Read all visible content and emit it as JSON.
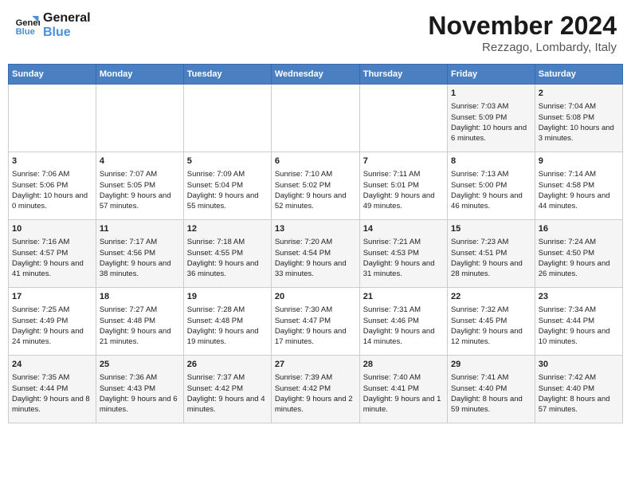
{
  "header": {
    "logo_line1": "General",
    "logo_line2": "Blue",
    "month_title": "November 2024",
    "location": "Rezzago, Lombardy, Italy"
  },
  "days_of_week": [
    "Sunday",
    "Monday",
    "Tuesday",
    "Wednesday",
    "Thursday",
    "Friday",
    "Saturday"
  ],
  "weeks": [
    [
      {
        "day": "",
        "info": ""
      },
      {
        "day": "",
        "info": ""
      },
      {
        "day": "",
        "info": ""
      },
      {
        "day": "",
        "info": ""
      },
      {
        "day": "",
        "info": ""
      },
      {
        "day": "1",
        "info": "Sunrise: 7:03 AM\nSunset: 5:09 PM\nDaylight: 10 hours and 6 minutes."
      },
      {
        "day": "2",
        "info": "Sunrise: 7:04 AM\nSunset: 5:08 PM\nDaylight: 10 hours and 3 minutes."
      }
    ],
    [
      {
        "day": "3",
        "info": "Sunrise: 7:06 AM\nSunset: 5:06 PM\nDaylight: 10 hours and 0 minutes."
      },
      {
        "day": "4",
        "info": "Sunrise: 7:07 AM\nSunset: 5:05 PM\nDaylight: 9 hours and 57 minutes."
      },
      {
        "day": "5",
        "info": "Sunrise: 7:09 AM\nSunset: 5:04 PM\nDaylight: 9 hours and 55 minutes."
      },
      {
        "day": "6",
        "info": "Sunrise: 7:10 AM\nSunset: 5:02 PM\nDaylight: 9 hours and 52 minutes."
      },
      {
        "day": "7",
        "info": "Sunrise: 7:11 AM\nSunset: 5:01 PM\nDaylight: 9 hours and 49 minutes."
      },
      {
        "day": "8",
        "info": "Sunrise: 7:13 AM\nSunset: 5:00 PM\nDaylight: 9 hours and 46 minutes."
      },
      {
        "day": "9",
        "info": "Sunrise: 7:14 AM\nSunset: 4:58 PM\nDaylight: 9 hours and 44 minutes."
      }
    ],
    [
      {
        "day": "10",
        "info": "Sunrise: 7:16 AM\nSunset: 4:57 PM\nDaylight: 9 hours and 41 minutes."
      },
      {
        "day": "11",
        "info": "Sunrise: 7:17 AM\nSunset: 4:56 PM\nDaylight: 9 hours and 38 minutes."
      },
      {
        "day": "12",
        "info": "Sunrise: 7:18 AM\nSunset: 4:55 PM\nDaylight: 9 hours and 36 minutes."
      },
      {
        "day": "13",
        "info": "Sunrise: 7:20 AM\nSunset: 4:54 PM\nDaylight: 9 hours and 33 minutes."
      },
      {
        "day": "14",
        "info": "Sunrise: 7:21 AM\nSunset: 4:53 PM\nDaylight: 9 hours and 31 minutes."
      },
      {
        "day": "15",
        "info": "Sunrise: 7:23 AM\nSunset: 4:51 PM\nDaylight: 9 hours and 28 minutes."
      },
      {
        "day": "16",
        "info": "Sunrise: 7:24 AM\nSunset: 4:50 PM\nDaylight: 9 hours and 26 minutes."
      }
    ],
    [
      {
        "day": "17",
        "info": "Sunrise: 7:25 AM\nSunset: 4:49 PM\nDaylight: 9 hours and 24 minutes."
      },
      {
        "day": "18",
        "info": "Sunrise: 7:27 AM\nSunset: 4:48 PM\nDaylight: 9 hours and 21 minutes."
      },
      {
        "day": "19",
        "info": "Sunrise: 7:28 AM\nSunset: 4:48 PM\nDaylight: 9 hours and 19 minutes."
      },
      {
        "day": "20",
        "info": "Sunrise: 7:30 AM\nSunset: 4:47 PM\nDaylight: 9 hours and 17 minutes."
      },
      {
        "day": "21",
        "info": "Sunrise: 7:31 AM\nSunset: 4:46 PM\nDaylight: 9 hours and 14 minutes."
      },
      {
        "day": "22",
        "info": "Sunrise: 7:32 AM\nSunset: 4:45 PM\nDaylight: 9 hours and 12 minutes."
      },
      {
        "day": "23",
        "info": "Sunrise: 7:34 AM\nSunset: 4:44 PM\nDaylight: 9 hours and 10 minutes."
      }
    ],
    [
      {
        "day": "24",
        "info": "Sunrise: 7:35 AM\nSunset: 4:44 PM\nDaylight: 9 hours and 8 minutes."
      },
      {
        "day": "25",
        "info": "Sunrise: 7:36 AM\nSunset: 4:43 PM\nDaylight: 9 hours and 6 minutes."
      },
      {
        "day": "26",
        "info": "Sunrise: 7:37 AM\nSunset: 4:42 PM\nDaylight: 9 hours and 4 minutes."
      },
      {
        "day": "27",
        "info": "Sunrise: 7:39 AM\nSunset: 4:42 PM\nDaylight: 9 hours and 2 minutes."
      },
      {
        "day": "28",
        "info": "Sunrise: 7:40 AM\nSunset: 4:41 PM\nDaylight: 9 hours and 1 minute."
      },
      {
        "day": "29",
        "info": "Sunrise: 7:41 AM\nSunset: 4:40 PM\nDaylight: 8 hours and 59 minutes."
      },
      {
        "day": "30",
        "info": "Sunrise: 7:42 AM\nSunset: 4:40 PM\nDaylight: 8 hours and 57 minutes."
      }
    ]
  ]
}
